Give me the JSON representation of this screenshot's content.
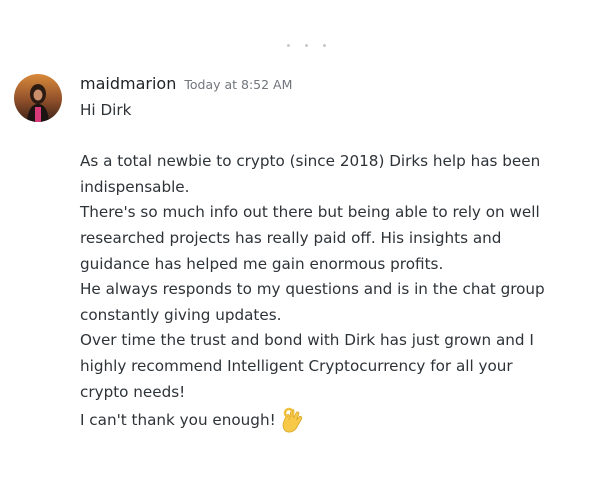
{
  "message": {
    "author": "maidmarion",
    "timestamp": "Today at 8:52 AM",
    "lines": {
      "l1": "Hi Dirk",
      "l2": "As a total newbie to crypto (since 2018) Dirks help has been",
      "l3": "indispensable.",
      "l4": "There's so much info out there but being able to rely on well",
      "l5": "researched projects has really paid off. His insights and",
      "l6": "guidance has helped me gain enormous profits.",
      "l7": "He always responds to my questions and is in the chat group",
      "l8": "constantly giving updates.",
      "l9": "Over time the trust and bond with Dirk has just grown and I",
      "l10": "highly recommend Intelligent Cryptocurrency for all your",
      "l11": "crypto needs!",
      "l12": "I can't thank you enough!"
    },
    "emoji": "ok-hand-icon",
    "colors": {
      "username": "#1f2225",
      "timestamp": "#72767d",
      "text": "#2e3338",
      "emoji": "#f7c948"
    }
  }
}
